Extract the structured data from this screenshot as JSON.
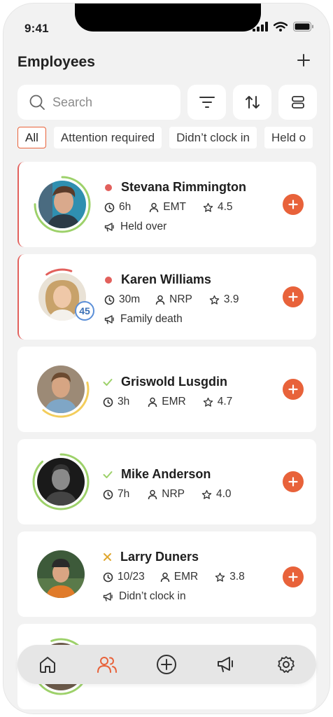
{
  "status_bar": {
    "time": "9:41"
  },
  "header": {
    "title": "Employees"
  },
  "search": {
    "placeholder": "Search",
    "value": ""
  },
  "filters": [
    "All",
    "Attention required",
    "Didn’t clock in",
    "Held o"
  ],
  "employees": [
    {
      "name": "Stevana Rimmington",
      "status": "alert",
      "time": "6h",
      "role": "EMT",
      "rating": "4.5",
      "note": "Held over",
      "ring_color": "#9dd16a",
      "ring_fraction": 0.75
    },
    {
      "name": "Karen Williams",
      "status": "alert",
      "time": "30m",
      "role": "NRP",
      "rating": "3.9",
      "note": "Family death",
      "badge": "45",
      "ring_color": "#e2605c",
      "ring_fraction": 0.15
    },
    {
      "name": "Griswold Lusgdin",
      "status": "check",
      "time": "3h",
      "role": "EMR",
      "rating": "4.7",
      "ring_color": "#f3cd5b",
      "ring_fraction": 0.4
    },
    {
      "name": "Mike Anderson",
      "status": "check",
      "time": "7h",
      "role": "NRP",
      "rating": "4.0",
      "ring_color": "#9dd16a",
      "ring_fraction": 0.88
    },
    {
      "name": "Larry Duners",
      "status": "cross",
      "time": "10/23",
      "role": "EMR",
      "rating": "3.8",
      "note": "Didn’t clock in"
    }
  ],
  "colors": {
    "accent": "#e8623a",
    "alert": "#e2605c",
    "success": "#9dd16a",
    "warning": "#e0a730"
  },
  "nav": [
    "home-icon",
    "users-icon",
    "plus-circle-icon",
    "megaphone-icon",
    "gear-icon"
  ]
}
